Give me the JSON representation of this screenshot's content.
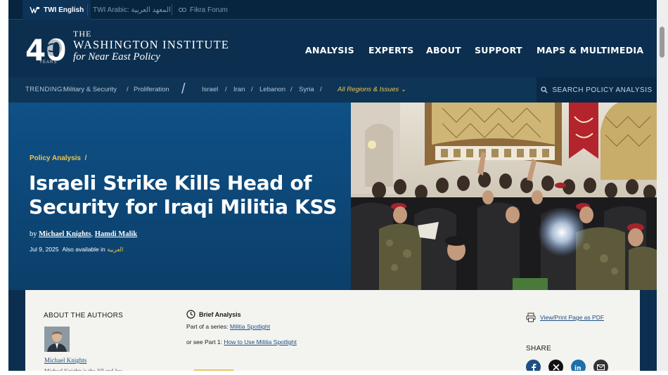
{
  "language_bar": {
    "items": [
      {
        "label": "TWI English",
        "active": true
      },
      {
        "label": "TWI Arabic: المعهد العربية",
        "active": false
      },
      {
        "label": "Fikra Forum",
        "active": false
      }
    ]
  },
  "logo": {
    "number": "40",
    "years": "YEARS",
    "line1": "THE",
    "line2": "WASHINGTON INSTITUTE",
    "line3": "for Near East Policy"
  },
  "main_nav": [
    "ANALYSIS",
    "EXPERTS",
    "ABOUT",
    "SUPPORT",
    "MAPS & MULTIMEDIA"
  ],
  "trending": {
    "label": "TRENDING:",
    "topics": [
      "Military & Security",
      "Proliferation"
    ],
    "regions": [
      "Israel",
      "Iran",
      "Lebanon",
      "Syria"
    ],
    "all_regions": "All Regions & Issues",
    "separator": "/"
  },
  "search": {
    "label": "SEARCH POLICY ANALYSIS"
  },
  "article": {
    "kicker": "Policy Analysis",
    "kicker_sep": "/",
    "title": "Israeli Strike Kills Head of Security for Iraqi Militia KSS",
    "by": "by",
    "authors": [
      "Michael Knights",
      "Hamdi Malik"
    ],
    "author_sep": ", ",
    "date": "Jul 9, 2025",
    "also_available": "Also available in",
    "arabic_label": "العربية"
  },
  "about": {
    "title": "ABOUT THE AUTHORS",
    "author_name": "Michael Knights",
    "author_bio_start": "Michael Knights is the Jill and Jay"
  },
  "brief": {
    "label": "Brief Analysis",
    "series_prefix": "Part of a series: ",
    "series_link": "Militia Spotlight",
    "part_prefix": "or see Part 1: ",
    "part_link": "How to Use Militia Spotlight"
  },
  "tools": {
    "pdf_label": "View/Print Page as PDF",
    "share_title": "SHARE",
    "share_icons": [
      "facebook-icon",
      "x-icon",
      "linkedin-icon",
      "email-icon"
    ]
  },
  "colors": {
    "navy": "#0c2f4f",
    "hero_blue": "#0f5086",
    "gold": "#f1c54a",
    "link": "#1d4f82"
  }
}
